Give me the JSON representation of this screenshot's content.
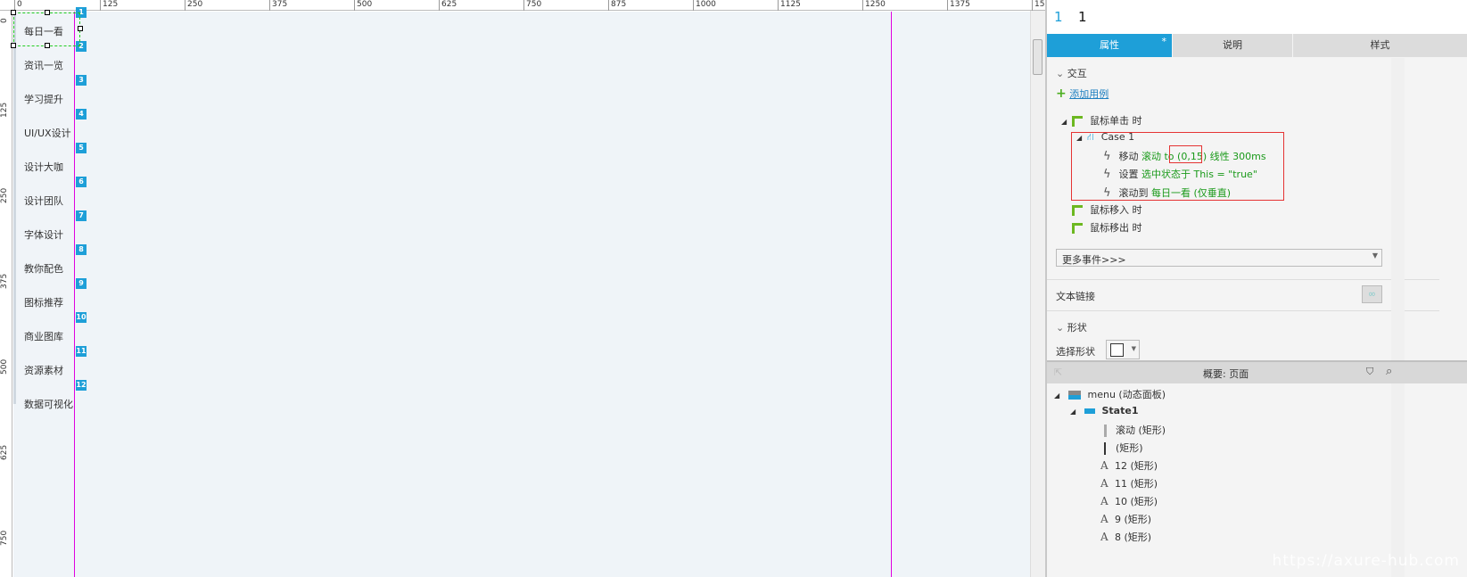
{
  "ruler": {
    "h": [
      "0",
      "125",
      "250",
      "375",
      "500",
      "625",
      "750",
      "875",
      "1000",
      "1125",
      "1250",
      "1375",
      "15"
    ],
    "v": [
      "0",
      "125",
      "250",
      "375",
      "500",
      "625",
      "750"
    ]
  },
  "menu": {
    "items": [
      "每日一看",
      "资讯一览",
      "学习提升",
      "UI/UX设计",
      "设计大咖",
      "设计团队",
      "字体设计",
      "教你配色",
      "图标推荐",
      "商业图库",
      "资源素材",
      "数据可视化"
    ],
    "badges": [
      "1",
      "2",
      "3",
      "4",
      "5",
      "6",
      "7",
      "8",
      "9",
      "10",
      "11",
      "12"
    ]
  },
  "panel": {
    "header": {
      "num": "1",
      "name": "1"
    },
    "tabs": [
      {
        "label": "属性",
        "active": true,
        "mark": "*"
      },
      {
        "label": "说明"
      },
      {
        "label": "样式"
      }
    ],
    "interaction_title": "交互",
    "add_case": "添加用例",
    "event_click": "鼠标单击 时",
    "case_name": "Case 1",
    "actions": [
      {
        "verb": "移动",
        "detail": "滚动 to (0,15) 线性 300ms"
      },
      {
        "verb": "设置",
        "detail": "选中状态于 This = \"true\""
      },
      {
        "verb": "滚动到",
        "detail": "每日一看 (仅垂直)"
      }
    ],
    "event_enter": "鼠标移入 时",
    "event_leave": "鼠标移出 时",
    "more_events": "更多事件>>>",
    "text_link": "文本链接",
    "shape_title": "形状",
    "shape_select": "选择形状"
  },
  "outline": {
    "title": "概要: 页面",
    "items": [
      {
        "label": "menu (动态面板)",
        "icon": "dynamic-panel-icon"
      },
      {
        "label": "State1",
        "icon": "state-icon"
      },
      {
        "label": "滚动 (矩形)",
        "icon": "rect-bar-icon"
      },
      {
        "label": "(矩形)",
        "icon": "rect-line-icon"
      },
      {
        "label": "12 (矩形)",
        "icon": "text-icon"
      },
      {
        "label": "11 (矩形)",
        "icon": "text-icon"
      },
      {
        "label": "10 (矩形)",
        "icon": "text-icon"
      },
      {
        "label": "9 (矩形)",
        "icon": "text-icon"
      },
      {
        "label": "8 (矩形)",
        "icon": "text-icon"
      }
    ]
  },
  "watermark": "https://axure-hub.com",
  "colors": {
    "accent": "#1e9fd8",
    "guide": "#e000e0",
    "action": "#1a9a1a",
    "highlight": "#e53333"
  }
}
